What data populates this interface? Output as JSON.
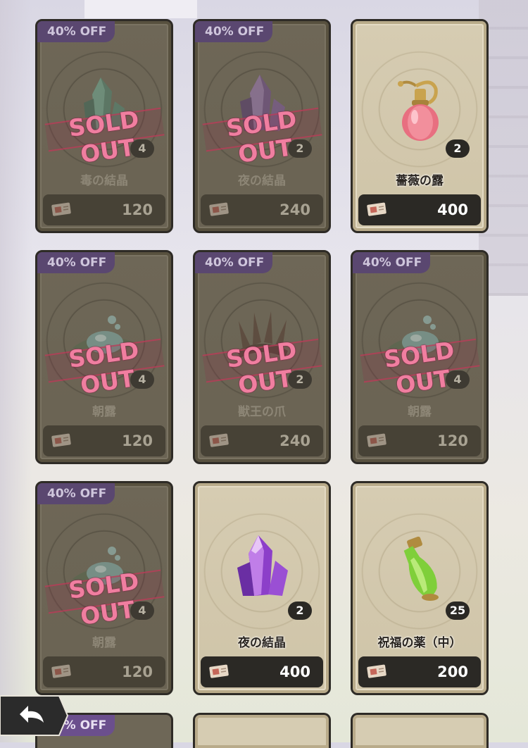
{
  "shop": {
    "items": [
      {
        "discount": "40% OFF",
        "name": "毒の結晶",
        "qty": "4",
        "price": "120",
        "sold_out": true,
        "icon": "green-crystal-icon"
      },
      {
        "discount": "40% OFF",
        "name": "夜の結晶",
        "qty": "2",
        "price": "240",
        "sold_out": true,
        "icon": "purple-crystal-icon"
      },
      {
        "discount": "",
        "name": "薔薇の露",
        "qty": "2",
        "price": "400",
        "sold_out": false,
        "icon": "rose-perfume-bottle-icon"
      },
      {
        "discount": "40% OFF",
        "name": "朝露",
        "qty": "4",
        "price": "120",
        "sold_out": true,
        "icon": "morning-dew-leaf-icon"
      },
      {
        "discount": "40% OFF",
        "name": "獣王の爪",
        "qty": "2",
        "price": "240",
        "sold_out": true,
        "icon": "beast-claw-icon"
      },
      {
        "discount": "40% OFF",
        "name": "朝露",
        "qty": "4",
        "price": "120",
        "sold_out": true,
        "icon": "morning-dew-leaf-icon"
      },
      {
        "discount": "40% OFF",
        "name": "朝露",
        "qty": "4",
        "price": "120",
        "sold_out": true,
        "icon": "morning-dew-leaf-icon"
      },
      {
        "discount": "",
        "name": "夜の結晶",
        "qty": "2",
        "price": "400",
        "sold_out": false,
        "icon": "purple-crystal-icon"
      },
      {
        "discount": "",
        "name": "祝福の薬（中）",
        "qty": "25",
        "price": "200",
        "sold_out": false,
        "icon": "green-potion-icon"
      }
    ],
    "sold_out_label": "SOLD OUT",
    "peek_discount": "40% OFF",
    "currency_icon": "ticket-icon"
  },
  "nav": {
    "back_icon": "back-arrow-icon"
  }
}
